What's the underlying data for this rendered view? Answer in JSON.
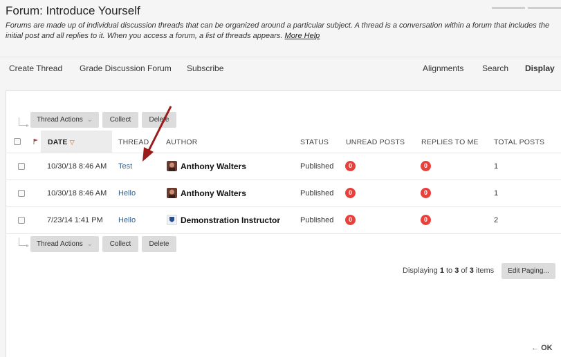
{
  "header": {
    "title": "Forum: Introduce Yourself",
    "description": "Forums are made up of individual discussion threads that can be organized around a particular subject. A thread is a conversation within a forum that includes the initial post and all replies to it. When you access a forum, a list of threads appears.",
    "more_help": "More Help"
  },
  "toolbar": {
    "create_thread": "Create Thread",
    "grade_forum": "Grade Discussion Forum",
    "subscribe": "Subscribe",
    "alignments": "Alignments",
    "search": "Search",
    "display": "Display"
  },
  "actions": {
    "thread_actions": "Thread Actions",
    "collect": "Collect",
    "delete": "Delete"
  },
  "table": {
    "columns": {
      "date": "DATE",
      "thread": "THREAD",
      "author": "AUTHOR",
      "status": "STATUS",
      "unread": "UNREAD POSTS",
      "replies_to_me": "REPLIES TO ME",
      "total": "TOTAL POSTS"
    },
    "rows": [
      {
        "date": "10/30/18 8:46 AM",
        "thread": "Test",
        "author": "Anthony Walters",
        "status": "Published",
        "unread": "0",
        "replies": "0",
        "total": "1"
      },
      {
        "date": "10/30/18 8:46 AM",
        "thread": "Hello",
        "author": "Anthony Walters",
        "status": "Published",
        "unread": "0",
        "replies": "0",
        "total": "1"
      },
      {
        "date": "7/23/14 1:41 PM",
        "thread": "Hello",
        "author": "Demonstration Instructor",
        "status": "Published",
        "unread": "0",
        "replies": "0",
        "total": "2"
      }
    ]
  },
  "pager": {
    "prefix": "Displaying",
    "from": "1",
    "to_word": "to",
    "to": "3",
    "of_word": "of",
    "total": "3",
    "suffix": "items",
    "edit_paging": "Edit Paging..."
  },
  "footer": {
    "ok": "OK"
  },
  "colors": {
    "badge": "#e8413c",
    "link": "#2f5e8e",
    "annotation_arrow": "#9b1a1a"
  }
}
